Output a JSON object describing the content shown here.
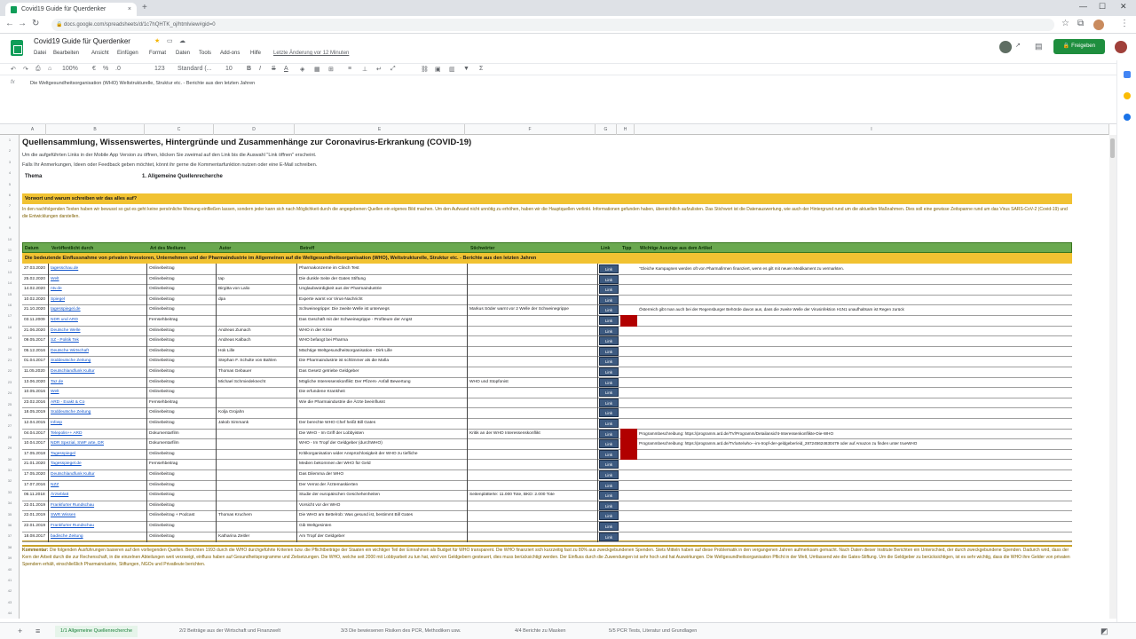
{
  "browser": {
    "tab_title": "Covid19 Guide für Querdenker",
    "tab_close": "×",
    "new_tab": "+",
    "url": "docs.google.com/spreadsheets/d/1c7hQHTK_oj/htmlview#gid=0"
  },
  "doc": {
    "title": "Covid19 Guide für Querdenker",
    "menus": [
      "Datei",
      "Bearbeiten",
      "Ansicht",
      "Einfügen",
      "Format",
      "Daten",
      "Tools",
      "Add-ons",
      "Hilfe"
    ],
    "last_edit": "Letzte Änderung vor 12 Minuten",
    "share_label": "Freigeben"
  },
  "toolbar": {
    "zoom": "100%",
    "currency": "€",
    "percent": "%",
    "decimals": ".0",
    "format": "123",
    "font": "Standard (...",
    "size": "10",
    "bold": "B",
    "italic": "I",
    "strike": "S",
    "textcolor": "A"
  },
  "formula": {
    "fx": "fx",
    "text": "Die Weltgesundheitsorganisation (WHO) Weltstrukturelle, Struktur etc. - Berichte aus den letzten Jahren"
  },
  "columns": [
    "A",
    "B",
    "C",
    "D",
    "E",
    "F",
    "G",
    "H",
    "I",
    "J"
  ],
  "sheet": {
    "title": "Quellensammlung, Wissenswertes, Hintergründe und Zusammenhänge zur Coronavirus-Erkrankung (COVID-19)",
    "intro_lines": [
      "Um die aufgeführten Links in der Mobile App Version zu öffnen, klicken Sie zweimal auf den Link bis die Auswahl \"Link öffnen\" erscheint.",
      "Falls Ihr Anmerkungen, Ideen oder Feedback geben möchtet, könnt ihr gerne die Kommentarfunktion nutzen oder eine E-Mail schreiben."
    ],
    "theme_label": "Thema",
    "theme_value": "1. Allgemeine Quellenrecherche",
    "section_heading": "Vorwort und warum schreiben wir das alles auf?",
    "section_text": "In den nachfolgenden Texten haben wir bewusst so gut es geht keine persönliche Meinung einfließen lassen, sondern jeder kann sich nach Möglichkeit durch die angegebenen Quellen ein eigenes Bild machen. Um den Aufwand nicht unnötig zu erhöhen, haben wir die Hauptquellen verlinkt. Informationen gefunden haben, übersichtlich aufzulisten. Das Stichwort ist die Datenauswertung, wie auch der Hintergrund rund um die aktuellen Maßnahmen. Dies soll eine gewisse Zeitspanne rund um das Virus SARS-CoV-2 (Covid-19) und die Entwicklungen darstellen.",
    "table_headers": [
      "Datum",
      "Veröffentlicht durch",
      "Art des Mediums",
      "Autor",
      "Betreff",
      "Stichwörter",
      "Link",
      "Tipp",
      "Wichtige Auszüge aus dem Artikel"
    ],
    "group_heading": "Die bedeutende Einflussnahme von privaten Investoren, Unternehmen und der Pharmaindustrie im Allgemeinen auf die Weltgesundheitsorganisation (WHO), Weltstrukturelle, Struktur etc. - Berichte aus den letzten Jahren",
    "link_label": "Link",
    "rows": [
      {
        "date": "27.03.2020",
        "source": "tagesschau.de",
        "medium": "Onlinebeitrag",
        "author": "",
        "subject": "Pharmakonzerne im Clinch Test",
        "keywords": "",
        "tip": false,
        "note": "\"Gleiche Kampagnen werden oft von Pharmafirmen finanziert, wenn es gilt mit neuen Medikament zu vermarkten."
      },
      {
        "date": "25.02.2020",
        "source": "Welt",
        "medium": "Onlinebeitrag",
        "author": "tap",
        "subject": "Die dunkle Seite der Gates Stiftung",
        "keywords": "",
        "tip": false,
        "note": ""
      },
      {
        "date": "14.02.2020",
        "source": "ntv.de",
        "medium": "Onlinebeitrag",
        "author": "Birgitta von Lalio",
        "subject": "Unglaubwürdigkeit aus der Pharmaindustrie",
        "keywords": "",
        "tip": false,
        "note": ""
      },
      {
        "date": "10.02.2020",
        "source": "Spiegel",
        "medium": "Onlinebeitrag",
        "author": "dpa",
        "subject": "Experte warnt vor Virus-Nachricht",
        "keywords": "",
        "tip": false,
        "note": ""
      },
      {
        "date": "21.10.2020",
        "source": "tagesspiegel.de",
        "medium": "Onlinebeitrag",
        "author": "",
        "subject": "Schweinegrippe: Die zweite Welle ist unterwegs",
        "keywords": "Markus Söder warnt vor 2 Welle der Schweinegrippe",
        "tip": false,
        "note": "Österreich gibt man auch bei der Regensburger Behörde davon aus, dass die zweite Welle der Virusinfektion H1N1 unaufhaltsam ist Regen zurück"
      },
      {
        "date": "03.11.2009",
        "source": "NDR und ARD",
        "medium": "Fernsehbeitrag",
        "author": "",
        "subject": "Das Geschäft mit der Schweinegrippe - Profiteure der Angst",
        "keywords": "",
        "tip": true,
        "note": ""
      },
      {
        "date": "21.06.2020",
        "source": "Deutsche Welle",
        "medium": "Onlinebeitrag",
        "author": "Andreas Zumach",
        "subject": "WHO in der Krise",
        "keywords": "",
        "tip": false,
        "note": ""
      },
      {
        "date": "09.05.2017",
        "source": "SZ - Politik Tek",
        "medium": "Onlinebeitrag",
        "author": "Andreas Kalbach",
        "subject": "WHO befangt bei Pharma",
        "keywords": "",
        "tip": false,
        "note": ""
      },
      {
        "date": "05.12.2016",
        "source": "Deutsche Wirtschaft",
        "medium": "Onlinebeitrag",
        "author": "Hok Lille",
        "subject": "Mächtige Weltgesundheitsorganisation - Dirk Lille",
        "keywords": "",
        "tip": false,
        "note": ""
      },
      {
        "date": "01.04.2017",
        "source": "Süddeutsche Zeitung",
        "medium": "Onlinebeitrag",
        "author": "Stephan F. Schulte von Bahlen",
        "subject": "Die Pharmaindustrie ist schlimmer als die Mafia",
        "keywords": "",
        "tip": false,
        "note": ""
      },
      {
        "date": "11.05.2020",
        "source": "Deutschlandfunk Kultur",
        "medium": "Onlinebeitrag",
        "author": "Thomas Gebauer",
        "subject": "Das Gesetz getriebe Geldgeber",
        "keywords": "",
        "tip": false,
        "note": ""
      },
      {
        "date": "13.06.2020",
        "source": "Taz.de",
        "medium": "Onlinebeitrag",
        "author": "Michael Schmiedeknecht",
        "subject": "Mögliche Interessenskonflikt: Der Pfizers- Anfall Bewertung",
        "keywords": "WHO und Stopfonist",
        "tip": false,
        "note": ""
      },
      {
        "date": "10.05.2016",
        "source": "Welt",
        "medium": "Onlinebeitrag",
        "author": "",
        "subject": "Die erfundene Krankheit",
        "keywords": "",
        "tip": false,
        "note": ""
      },
      {
        "date": "23.02.2016",
        "source": "ARD - Exakt & Co",
        "medium": "Fernsehbeitrag",
        "author": "",
        "subject": "Wie die Pharmaindustrie die Ärzte beeinflusst",
        "keywords": "",
        "tip": false,
        "note": ""
      },
      {
        "date": "18.05.2019",
        "source": "Süddeutsche Zeitung",
        "medium": "Onlinebeitrag",
        "author": "Kolja Grojahn",
        "subject": "",
        "keywords": "",
        "tip": false,
        "note": ""
      },
      {
        "date": "12.04.2015",
        "source": "Infosp",
        "medium": "Onlinebeitrag",
        "author": "Jakob Simmank",
        "subject": "Der berechte WHO Chef heißt Bill Gates",
        "keywords": "",
        "tip": false,
        "note": ""
      },
      {
        "date": "04.04.2017",
        "source": "Telepolis++ ARD",
        "medium": "Dokumentarfilm",
        "author": "",
        "subject": "Die WHO - Im Griff der Lobbyisten",
        "keywords": "Kritik an der WHO Interessenskonflikt",
        "tip": true,
        "note": "Programmbeschreibung: https://programm.ard.de/TV/Programm/Detailansicht-Interessenkonflikte-Die-WHO"
      },
      {
        "date": "10.04.2017",
        "source": "NDR Spezial, SWF arte, DR",
        "medium": "Dokumentarfilm",
        "author": "",
        "subject": "WHO - Im Tropf der Geldgeber (durchWHO)",
        "keywords": "",
        "tip": true,
        "note": "Programmbeschreibung: https://programm.ard.de/TV/arte/who---im-tropf-der-geldgeber/eid_287245624630479 oder auf Amazon zu finden unter trueWHO"
      },
      {
        "date": "17.05.2018",
        "source": "Tagesspiegel",
        "medium": "Onlinebeitrag",
        "author": "",
        "subject": "Kritikorganisation wider Ansprüchlosigkeit der WHO zu tiefliche",
        "keywords": "",
        "tip": true,
        "note": ""
      },
      {
        "date": "21.01.2020",
        "source": "Tagesspiegel.de",
        "medium": "Fernsehbeitrag",
        "author": "",
        "subject": "Medien bekommen der WHO für Geld",
        "keywords": "",
        "tip": false,
        "note": ""
      },
      {
        "date": "17.05.2020",
        "source": "Deutschlandfunk Kultur",
        "medium": "Onlinebeitrag",
        "author": "",
        "subject": "Das Dilemma der WHO",
        "keywords": "",
        "tip": false,
        "note": ""
      },
      {
        "date": "17.07.2016",
        "source": "NZZ",
        "medium": "Onlinebeitrag",
        "author": "",
        "subject": "Der Verrat der Ärztemaskierten",
        "keywords": "",
        "tip": false,
        "note": ""
      },
      {
        "date": "06.11.2018",
        "source": "Ärzteblatt",
        "medium": "Onlinebeitrag",
        "author": "",
        "subject": "Studie der europäischen Geschehenheiten",
        "keywords": "Seitenplätterte: 11.000 Tote, BKD: 2.000 Tote",
        "tip": false,
        "note": ""
      },
      {
        "date": "22.01.2019",
        "source": "Frankfurter Rundschau",
        "medium": "Onlinebeitrag",
        "author": "",
        "subject": "Vorsicht vor der WHO",
        "keywords": "",
        "tip": false,
        "note": ""
      },
      {
        "date": "22.01.2019",
        "source": "SWR Wissen",
        "medium": "Onlinebeitrag + Podcast",
        "author": "Thomas Kruchem",
        "subject": "Die WHO am Bettelrob: Was gesund ist, bestimmt Bill Gates",
        "keywords": "",
        "tip": false,
        "note": ""
      },
      {
        "date": "22.01.2019",
        "source": "Frankfurter Rundschau",
        "medium": "Onlinebeitrag",
        "author": "",
        "subject": "Gib Weltgesinten",
        "keywords": "",
        "tip": false,
        "note": ""
      },
      {
        "date": "18.08.2017",
        "source": "badische Zeitung",
        "medium": "Onlinebeitrag",
        "author": "Katharina Zeitler",
        "subject": "Am Tropf der Geldgeber",
        "keywords": "",
        "tip": false,
        "note": ""
      }
    ],
    "summary_label": "Kommentar:",
    "summary_text": "Die folgenden Ausführungen basieren auf den vorliegenden Quellen. Berichten 1993 durch die WHO durchgeführte Kriterien bzw. die Pflichtbeiträge der Staaten ein wichtiger Teil der Einnahmen als Budget für WHO transparent. Die WHO finanziert sich kurzzeitig fast zu 80% aus zweckgebundenen Spenden. Stets Mitteln haben auf diese Problematik in den vergangenen Jahren aufmerksam gemacht. Nach Daten dieser Institute Berichten ein Unterschied, der durch zweckgebundene Spenden. Dadurch wird, dass der Kern der Arbeit durch die zur Rechenschaft, in die einzelnen Abteilungen weit verzweigt, einfluss haben auf Gesundheitsprogramme und Zielsetzungen. Die WHO, welche seit 2000 mit Lobbyarbeit zu tun hat, wird von Geldgebern gesteuert, dies muss berücksichtigt werden. Der Einfluss durch die Zuwendungen ist sehr hoch und hat Auswirkungen.\nDie Weltgesundheitsorganisation Pflicht in der Welt, Umfassend wie die Gates-Stiftung. Um die Geldgeber zu berücksichtigen, ist es sehr wichtig, dass die WHO ihre Gelder von privaten Spendern erhält, einschließlich Pharmaindustrie, Stiftungen, NGOs und Privatleute berichten."
  },
  "sheet_tabs": [
    "1/1 Allgemeine Quellenrecherche",
    "2/2 Beiträge aus der Wirtschaft und Finanzwelt",
    "3/3 Die bewiesenen Risiken des PCR, Methodiken usw.",
    "4/4 Berichte zu Masken",
    "5/5 PCR Tests, Literatur und Grundlagen"
  ],
  "colors": {
    "accent_green": "#0f9d58",
    "share_green": "#1e8e3e",
    "header_yellow": "#f1c232",
    "table_header_green": "#6aa84f",
    "tip_red": "#b10000",
    "link_blue": "#1155cc",
    "link_button": "#3d5a80"
  }
}
